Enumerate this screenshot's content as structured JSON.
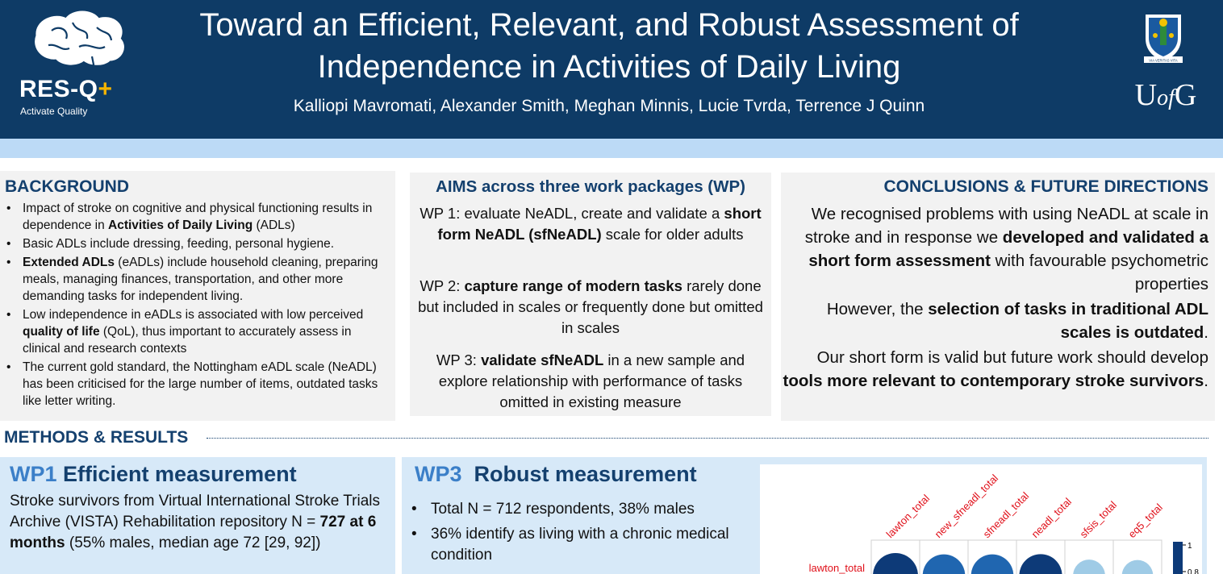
{
  "header": {
    "title_line1": "Toward an Efficient, Relevant, and Robust Assessment of",
    "title_line2": "Independence in Activities of Daily Living",
    "authors": "Kalliopi Mavromati, Alexander Smith, Meghan Minnis, Lucie Tvrda, Terrence J Quinn",
    "brand_name": "RES-Q",
    "brand_plus": "+",
    "brand_tagline": "Activate Quality",
    "crest_motto": "VIA VERITAS VITA",
    "uni_logo_u": "U",
    "uni_logo_of": "of",
    "uni_logo_g": "G"
  },
  "background": {
    "heading": "BACKGROUND",
    "items": [
      {
        "pre": "Impact of stroke on cognitive and physical functioning results in dependence in ",
        "bold": "Activities of Daily Living",
        "post": " (ADLs)"
      },
      {
        "pre": "Basic ADLs include dressing, feeding, personal hygiene.",
        "bold": "",
        "post": ""
      },
      {
        "pre": "",
        "bold": "Extended ADLs",
        "post": " (eADLs) include household cleaning, preparing meals, managing finances, transportation, and other more demanding tasks for independent living."
      },
      {
        "pre": "Low independence in eADLs is associated with low perceived ",
        "bold": "quality of life",
        "post": " (QoL), thus important to accurately assess in clinical and research contexts"
      },
      {
        "pre": "The current gold standard, the Nottingham eADL scale (NeADL) has been criticised for the large number of items, outdated tasks like letter writing.",
        "bold": "",
        "post": ""
      }
    ]
  },
  "aims": {
    "heading": "AIMS across three work packages (WP)",
    "wp1": {
      "pre": "WP 1: evaluate NeADL, create and validate a ",
      "bold": "short form NeADL (sfNeADL)",
      "post": " scale for older adults"
    },
    "wp2": {
      "pre": "WP 2: ",
      "bold": "capture range of modern tasks",
      "post": " rarely done but included in scales or frequently done but omitted in scales"
    },
    "wp3": {
      "pre": "WP 3: ",
      "bold": "validate sfNeADL",
      "post": " in a new sample and explore relationship with performance of tasks omitted in existing measure"
    }
  },
  "conclusions": {
    "heading": "CONCLUSIONS & FUTURE DIRECTIONS",
    "p1": {
      "pre": "We recognised problems with using NeADL at scale in stroke and in response we ",
      "bold": "developed and validated a short form assessment",
      "post": " with favourable psychometric properties"
    },
    "p2": {
      "pre": "However, the ",
      "bold": "selection of tasks in traditional ADL scales is outdated",
      "post": "."
    },
    "p3": {
      "pre": "Our short form is valid but future work should develop ",
      "bold": "tools more relevant to contemporary stroke survivors",
      "post": "."
    }
  },
  "methods": {
    "heading": "METHODS & RESULTS",
    "wp1": {
      "tag": "WP1",
      "title": "Efficient measurement",
      "text_pre": "Stroke survivors from  Virtual International Stroke Trials Archive (VISTA) Rehabilitation repository N = ",
      "text_bold": "727 at 6 months",
      "text_post": " (55% males, median age 72 [29, 92])"
    },
    "wp3": {
      "tag": "WP3",
      "title": "Robust measurement",
      "items": [
        "Total N = 712 respondents, 38% males",
        "36% identify as living with a chronic medical condition"
      ]
    }
  },
  "chart_data": {
    "type": "heatmap",
    "variables": [
      "lawton_total",
      "new_sfneadl_total",
      "sfneadl_total",
      "neadl_total",
      "sfsis_total",
      "eq5_total"
    ],
    "visible_rows": [
      "lawton_total"
    ],
    "matrix": [
      [
        1.0,
        0.88,
        0.88,
        0.9,
        0.42,
        0.38
      ]
    ],
    "colorbar_ticks": [
      "1",
      "0.8"
    ],
    "colors": {
      "high": "#0d3a78",
      "mid": "#2066b0",
      "low": "#9fcbe6",
      "label": "#e0101a"
    }
  }
}
